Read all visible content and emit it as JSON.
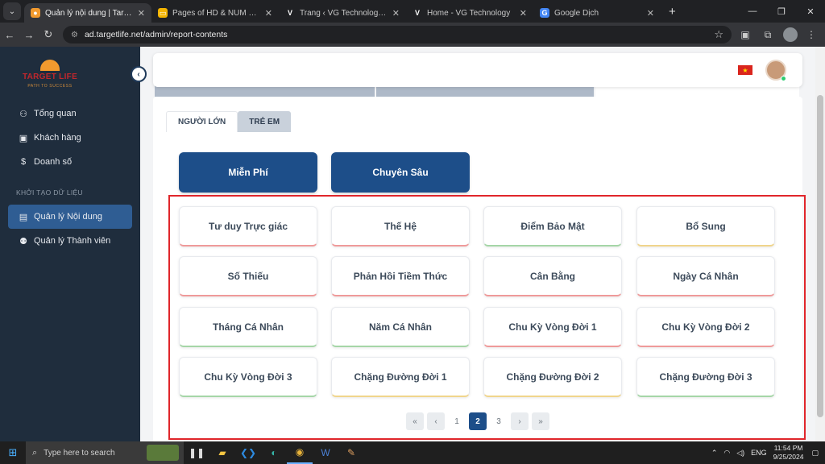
{
  "browser": {
    "tabs": [
      {
        "title": "Quản lý nội dung | Target Life",
        "favicon": "target-life-icon",
        "active": true
      },
      {
        "title": "Pages of HD & NUM web - Goo",
        "favicon": "google-slides-icon",
        "active": false
      },
      {
        "title": "Trang ‹ VG Technology — Word",
        "favicon": "vg-icon",
        "active": false
      },
      {
        "title": "Home - VG Technology",
        "favicon": "vg-icon",
        "active": false
      },
      {
        "title": "Google Dịch",
        "favicon": "google-translate-icon",
        "active": false
      }
    ],
    "url": "ad.targetlife.net/admin/report-contents"
  },
  "sidebar": {
    "logo_brand": "TARGET LIFE",
    "logo_tagline": "PATH TO SUCCESS",
    "items": [
      {
        "label": "Tổng quan",
        "icon": "dashboard-icon"
      },
      {
        "label": "Khách hàng",
        "icon": "contact-icon"
      },
      {
        "label": "Doanh số",
        "icon": "dollar-icon"
      }
    ],
    "section_title": "KHỞI TẠO DỮ LIỆU",
    "section_items": [
      {
        "label": "Quản lý Nội dung",
        "icon": "folder-icon",
        "active": true
      },
      {
        "label": "Quản lý Thành viên",
        "icon": "users-icon",
        "active": false
      }
    ]
  },
  "main": {
    "audience_tabs": [
      {
        "label": "NGƯỜI LỚN",
        "active": true
      },
      {
        "label": "TRẺ EM",
        "active": false
      }
    ],
    "category_buttons": [
      "Miễn Phí",
      "Chuyên Sâu"
    ],
    "content_items": [
      "Tư duy Trực giác",
      "Thế Hệ",
      "Điểm Bảo Mật",
      "Bổ Sung",
      "Số Thiếu",
      "Phản Hồi Tiềm Thức",
      "Cân Bằng",
      "Ngày Cá Nhân",
      "Tháng Cá Nhân",
      "Năm Cá Nhân",
      "Chu Kỳ Vòng Đời 1",
      "Chu Kỳ Vòng Đời 2",
      "Chu Kỳ Vòng Đời 3",
      "Chặng Đường Đời 1",
      "Chặng Đường Đời 2",
      "Chặng Đường Đời 3"
    ],
    "pagination": {
      "first": "«",
      "prev": "‹",
      "pages": [
        "1",
        "2",
        "3"
      ],
      "current": "2",
      "next": "›",
      "last": "»"
    }
  },
  "taskbar": {
    "search_placeholder": "Type here to search",
    "language": "ENG",
    "time": "11:54 PM",
    "date": "9/25/2024"
  },
  "colors": {
    "primary": "#1d4e89",
    "sidebar_bg": "#1f2d3d",
    "highlight": "#e0262b"
  }
}
